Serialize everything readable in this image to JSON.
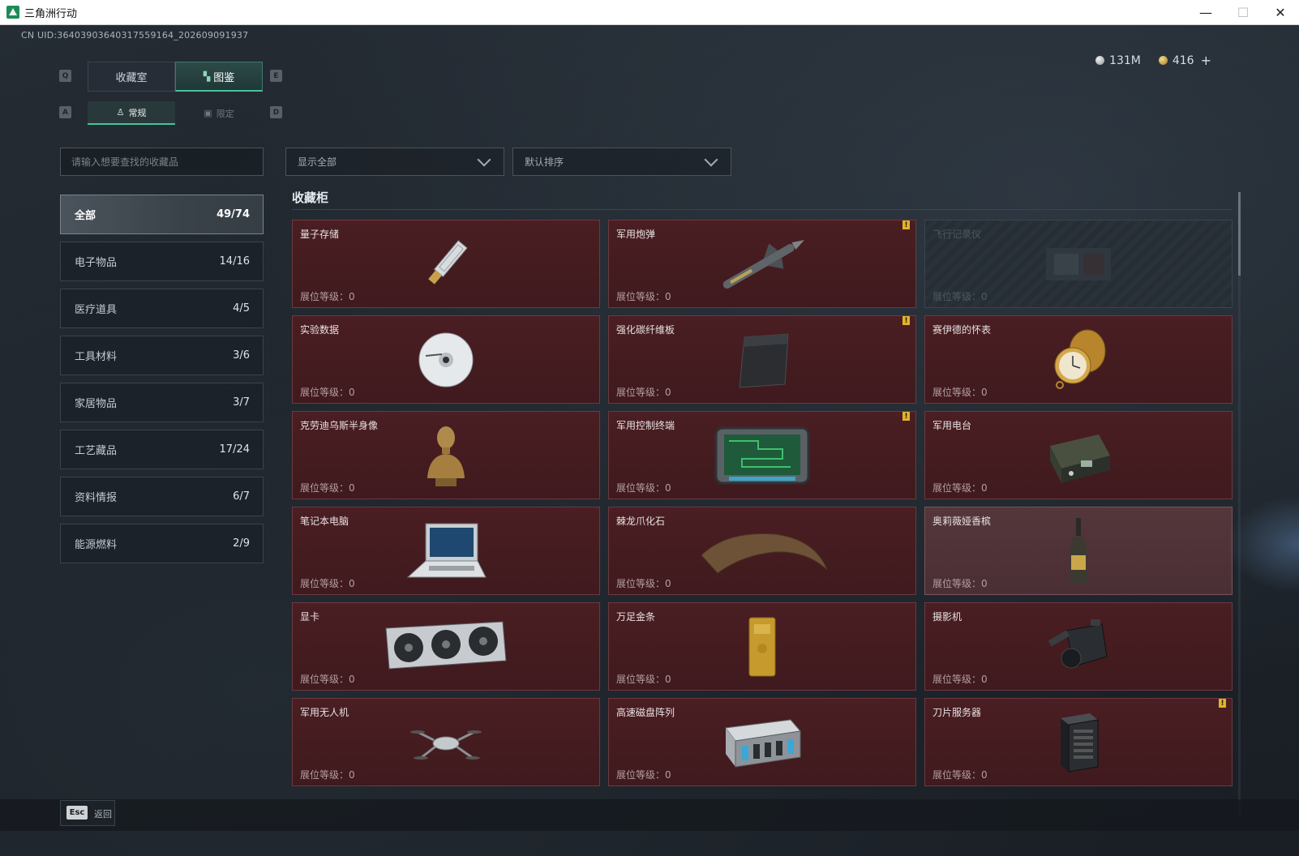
{
  "window": {
    "title": "三角洲行动",
    "minimize": "—",
    "maximize": "☐",
    "close": "✕"
  },
  "uid": "CN UID:3640390364031755916​4_202609091937",
  "currency": {
    "silver": "131M",
    "gold": "416",
    "add": "+"
  },
  "keys": {
    "q": "Q",
    "e": "E",
    "a": "A",
    "d": "D",
    "esc": "Esc"
  },
  "tabs_main": [
    {
      "label": "收藏室"
    },
    {
      "label": "图鉴"
    }
  ],
  "tabs_sub": [
    {
      "label": "常规"
    },
    {
      "label": "限定"
    }
  ],
  "search": {
    "placeholder": "请输入想要查找的收藏品"
  },
  "filter_dropdown": {
    "value": "显示全部"
  },
  "sort_dropdown": {
    "value": "默认排序"
  },
  "categories": [
    {
      "label": "全部",
      "count": "49/74"
    },
    {
      "label": "电子物品",
      "count": "14/16"
    },
    {
      "label": "医疗道具",
      "count": "4/5"
    },
    {
      "label": "工具材料",
      "count": "3/6"
    },
    {
      "label": "家居物品",
      "count": "3/7"
    },
    {
      "label": "工艺藏品",
      "count": "17/24"
    },
    {
      "label": "资料情报",
      "count": "6/7"
    },
    {
      "label": "能源燃料",
      "count": "2/9"
    }
  ],
  "section_title": "收藏柜",
  "level_label": "展位等级：0",
  "alert_mark": "!",
  "items": [
    {
      "name": "量子存储",
      "icon": "usb-drive-icon"
    },
    {
      "name": "军用炮弹",
      "icon": "missile-icon",
      "alert": true
    },
    {
      "name": "飞行记录仪",
      "icon": "flight-recorder-icon",
      "locked": true
    },
    {
      "name": "实验数据",
      "icon": "disc-icon"
    },
    {
      "name": "强化碳纤维板",
      "icon": "carbon-plate-icon",
      "alert": true
    },
    {
      "name": "赛伊德的怀表",
      "icon": "pocket-watch-icon"
    },
    {
      "name": "克劳迪乌斯半身像",
      "icon": "bust-icon"
    },
    {
      "name": "军用控制终端",
      "icon": "control-terminal-icon",
      "alert": true
    },
    {
      "name": "军用电台",
      "icon": "radio-icon"
    },
    {
      "name": "笔记本电脑",
      "icon": "laptop-icon"
    },
    {
      "name": "棘龙爪化石",
      "icon": "claw-fossil-icon"
    },
    {
      "name": "奥莉薇娅香槟",
      "icon": "champagne-icon",
      "light": true
    },
    {
      "name": "显卡",
      "icon": "graphics-card-icon"
    },
    {
      "name": "万足金条",
      "icon": "gold-bar-icon"
    },
    {
      "name": "摄影机",
      "icon": "camera-icon"
    },
    {
      "name": "军用无人机",
      "icon": "drone-icon"
    },
    {
      "name": "高速磁盘阵列",
      "icon": "disk-array-icon"
    },
    {
      "name": "刀片服务器",
      "icon": "blade-server-icon",
      "alert": true
    }
  ],
  "back_label": "返回"
}
